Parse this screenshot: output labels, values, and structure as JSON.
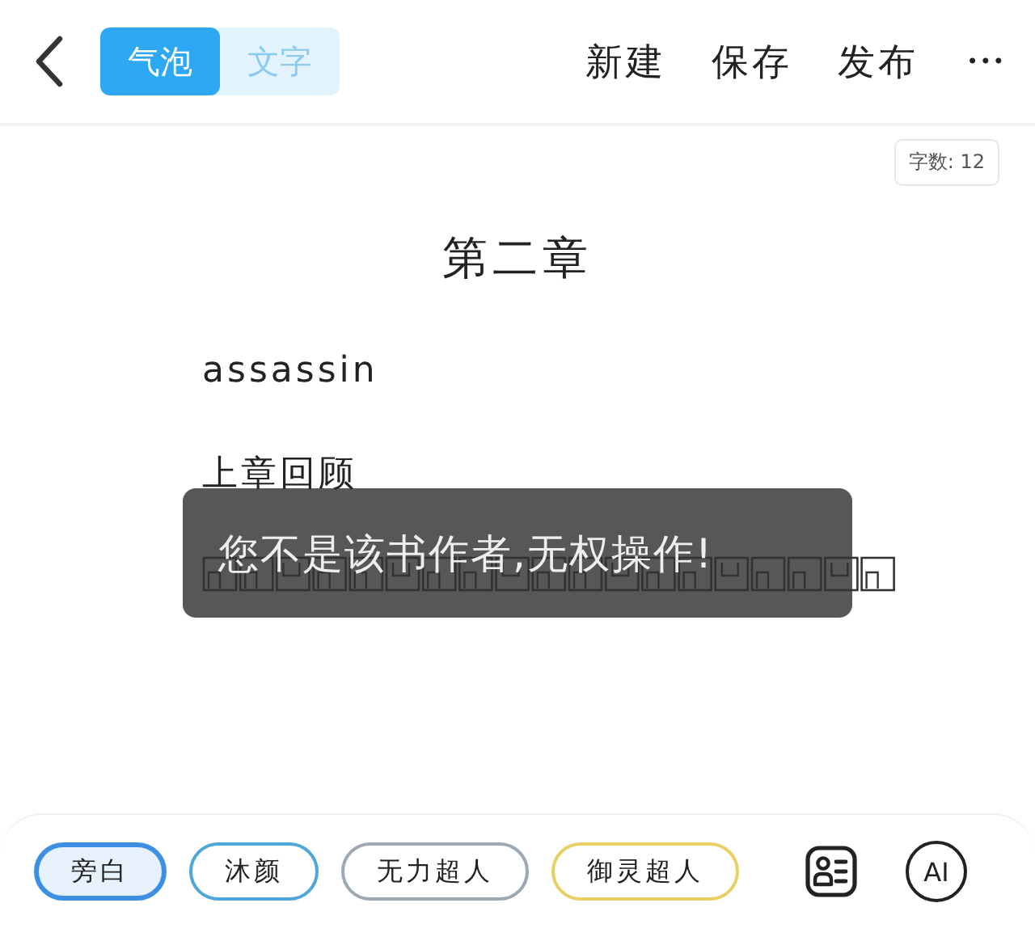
{
  "top_bar": {
    "modes": [
      {
        "label": "气泡",
        "selected": true
      },
      {
        "label": "文字",
        "selected": false
      }
    ],
    "actions": [
      "新建",
      "保存",
      "发布"
    ],
    "more": "•••"
  },
  "word_count": "字数: 12",
  "chapter_title": "第二章",
  "paragraphs": [
    "assassin",
    "上章回顾"
  ],
  "toast": "您不是该书作者,无权操作!",
  "speakers": [
    {
      "label": "旁白",
      "color": "#3d8fe2",
      "selected": true
    },
    {
      "label": "沐颜",
      "color": "#4fa6da",
      "selected": false
    },
    {
      "label": "无力超人",
      "color": "#9ea8b3",
      "selected": false
    },
    {
      "label": "御灵超人",
      "color": "#e9d065",
      "selected": false
    }
  ],
  "ai_button": "AI"
}
